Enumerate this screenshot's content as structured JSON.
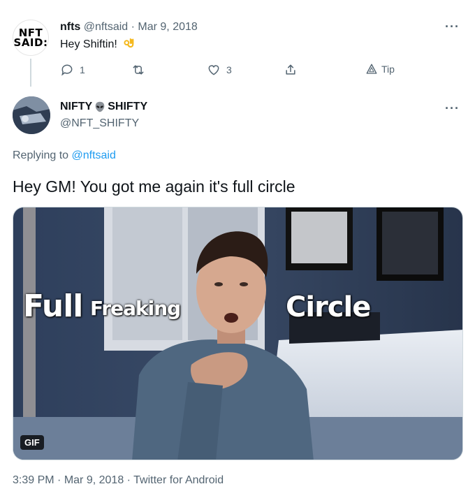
{
  "parent_tweet": {
    "avatar_text_line1": "NFT",
    "avatar_text_line2": "SAID:",
    "display_name": "nfts",
    "handle": "@nftsaid",
    "separator": "·",
    "date": "Mar 9, 2018",
    "text": "Hey Shiftin!",
    "emoji": "ok-hand-icon",
    "more_label": "···",
    "actions": {
      "reply_count": "1",
      "like_count": "3",
      "tip_label": "Tip"
    }
  },
  "reply_tweet": {
    "display_name_part1": "NIFTY",
    "display_name_emoji": "alien-icon",
    "display_name_part2": "SHIFTY",
    "handle": "@NFT_SHIFTY",
    "more_label": "···",
    "replying_prefix": "Replying to",
    "replying_to": "@nftsaid",
    "text": "Hey GM! You got me again it's full circle",
    "media": {
      "badge": "GIF",
      "caption_1": "Full",
      "caption_2": "Freaking",
      "caption_3": "Circle"
    },
    "footer": {
      "time": "3:39 PM",
      "separator": "·",
      "date": "Mar 9, 2018",
      "source": "Twitter for Android"
    }
  },
  "colors": {
    "text": "#0f1419",
    "muted": "#536471",
    "link": "#1d9bf0",
    "border": "#cfd9de"
  }
}
